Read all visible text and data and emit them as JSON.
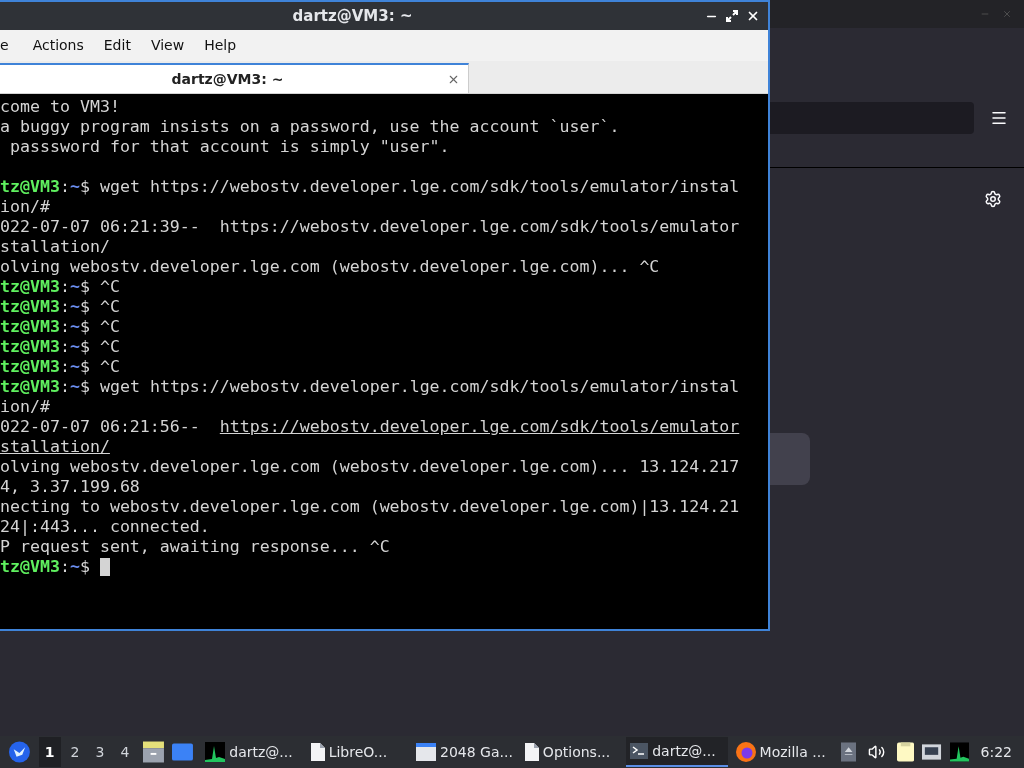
{
  "terminal_window": {
    "title": "dartz@VM3: ~",
    "menu": [
      "e",
      "Actions",
      "Edit",
      "View",
      "Help"
    ],
    "tabs": [
      {
        "label": "dartz@VM3: ~",
        "selected": true
      }
    ],
    "lines": [
      {
        "kind": "text",
        "text": "come to VM3!"
      },
      {
        "kind": "text",
        "text": "a buggy program insists on a password, use the account `user`."
      },
      {
        "kind": "text",
        "text": " passsword for that account is simply \"user\"."
      },
      {
        "kind": "blank"
      },
      {
        "kind": "prompt",
        "user": "tz@VM3",
        "sep": ":",
        "path": "~",
        "symbol": "$",
        "command": " wget https://webostv.developer.lge.com/sdk/tools/emulator/instal",
        "cursor": false
      },
      {
        "kind": "text",
        "text": "ion/#"
      },
      {
        "kind": "text",
        "text": "022-07-07 06:21:39--  https://webostv.developer.lge.com/sdk/tools/emulator"
      },
      {
        "kind": "text",
        "text": "stallation/"
      },
      {
        "kind": "text",
        "text": "olving webostv.developer.lge.com (webostv.developer.lge.com)... ^C"
      },
      {
        "kind": "prompt",
        "user": "tz@VM3",
        "sep": ":",
        "path": "~",
        "symbol": "$",
        "command": " ^C",
        "cursor": false
      },
      {
        "kind": "prompt",
        "user": "tz@VM3",
        "sep": ":",
        "path": "~",
        "symbol": "$",
        "command": " ^C",
        "cursor": false
      },
      {
        "kind": "prompt",
        "user": "tz@VM3",
        "sep": ":",
        "path": "~",
        "symbol": "$",
        "command": " ^C",
        "cursor": false
      },
      {
        "kind": "prompt",
        "user": "tz@VM3",
        "sep": ":",
        "path": "~",
        "symbol": "$",
        "command": " ^C",
        "cursor": false
      },
      {
        "kind": "prompt",
        "user": "tz@VM3",
        "sep": ":",
        "path": "~",
        "symbol": "$",
        "command": " ^C",
        "cursor": false
      },
      {
        "kind": "prompt",
        "user": "tz@VM3",
        "sep": ":",
        "path": "~",
        "symbol": "$",
        "command": " wget https://webostv.developer.lge.com/sdk/tools/emulator/instal",
        "cursor": false
      },
      {
        "kind": "text",
        "text": "ion/#"
      },
      {
        "kind": "link",
        "prefix": "022-07-07 06:21:56--  ",
        "link": "https://webostv.developer.lge.com/sdk/tools/emulator"
      },
      {
        "kind": "link",
        "link": "stallation/"
      },
      {
        "kind": "text",
        "text": "olving webostv.developer.lge.com (webostv.developer.lge.com)... 13.124.217"
      },
      {
        "kind": "text",
        "text": "4, 3.37.199.68"
      },
      {
        "kind": "text",
        "text": "necting to webostv.developer.lge.com (webostv.developer.lge.com)|13.124.21"
      },
      {
        "kind": "text",
        "text": "24|:443... connected."
      },
      {
        "kind": "text",
        "text": "P request sent, awaiting response... ^C"
      },
      {
        "kind": "prompt",
        "user": "tz@VM3",
        "sep": ":",
        "path": "~",
        "symbol": "$",
        "cursor": true
      }
    ]
  },
  "taskbar": {
    "workspaces": [
      {
        "label": "1",
        "selected": true
      },
      {
        "label": "2",
        "selected": false
      },
      {
        "label": "3",
        "selected": false
      },
      {
        "label": "4",
        "selected": false
      }
    ],
    "tasks": [
      {
        "kind": "monitor",
        "label": "dartz@...",
        "selected": false
      },
      {
        "kind": "document",
        "label": "LibreO...",
        "selected": false
      },
      {
        "kind": "window",
        "label": "2048 Ga...",
        "selected": false
      },
      {
        "kind": "document",
        "label": "Options...",
        "selected": false
      },
      {
        "kind": "terminal",
        "label": "dartz@...",
        "selected": true
      },
      {
        "kind": "browser",
        "label": "Mozilla ...",
        "selected": false
      }
    ],
    "clock": "6:22"
  }
}
